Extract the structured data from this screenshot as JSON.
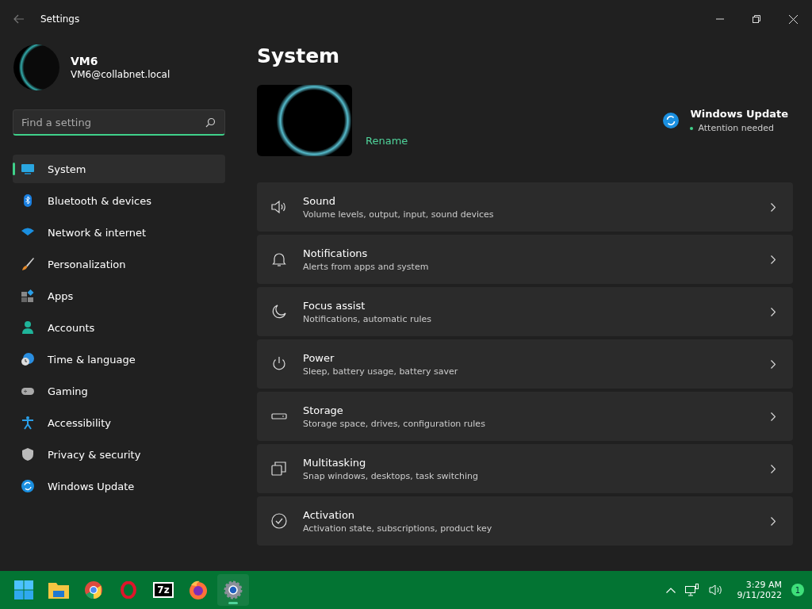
{
  "window": {
    "title": "Settings"
  },
  "account": {
    "name": "VM6",
    "email": "VM6@collabnet.local"
  },
  "search": {
    "placeholder": "Find a setting"
  },
  "sidebar": {
    "items": [
      {
        "label": "System",
        "selected": true
      },
      {
        "label": "Bluetooth & devices",
        "selected": false
      },
      {
        "label": "Network & internet",
        "selected": false
      },
      {
        "label": "Personalization",
        "selected": false
      },
      {
        "label": "Apps",
        "selected": false
      },
      {
        "label": "Accounts",
        "selected": false
      },
      {
        "label": "Time & language",
        "selected": false
      },
      {
        "label": "Gaming",
        "selected": false
      },
      {
        "label": "Accessibility",
        "selected": false
      },
      {
        "label": "Privacy & security",
        "selected": false
      },
      {
        "label": "Windows Update",
        "selected": false
      }
    ]
  },
  "page": {
    "title": "System",
    "rename": "Rename",
    "update": {
      "title": "Windows Update",
      "status": "Attention needed"
    },
    "cards": [
      {
        "title": "Sound",
        "subtitle": "Volume levels, output, input, sound devices"
      },
      {
        "title": "Notifications",
        "subtitle": "Alerts from apps and system"
      },
      {
        "title": "Focus assist",
        "subtitle": "Notifications, automatic rules"
      },
      {
        "title": "Power",
        "subtitle": "Sleep, battery usage, battery saver"
      },
      {
        "title": "Storage",
        "subtitle": "Storage space, drives, configuration rules"
      },
      {
        "title": "Multitasking",
        "subtitle": "Snap windows, desktops, task switching"
      },
      {
        "title": "Activation",
        "subtitle": "Activation state, subscriptions, product key"
      }
    ]
  },
  "taskbar": {
    "apps": [
      {
        "kind": "start",
        "selected": false
      },
      {
        "kind": "folder",
        "selected": false
      },
      {
        "kind": "chrome",
        "selected": false
      },
      {
        "kind": "opera",
        "selected": false
      },
      {
        "kind": "archiver",
        "label": "7z",
        "selected": false
      },
      {
        "kind": "firefox",
        "selected": false
      },
      {
        "kind": "settings",
        "selected": true
      }
    ],
    "time": "3:29 AM",
    "date": "9/11/2022",
    "notifications": "1"
  }
}
